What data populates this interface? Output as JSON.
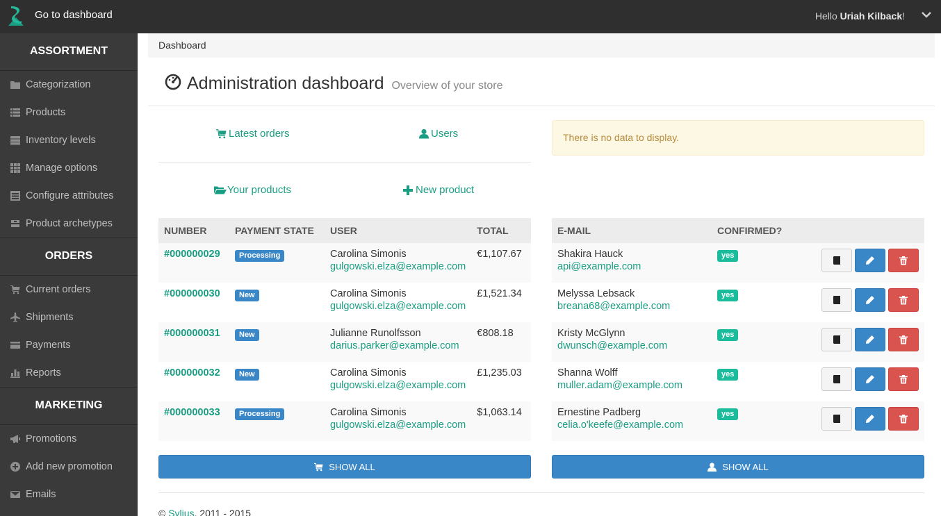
{
  "topbar": {
    "brand_label": "Go to dashboard",
    "hello_prefix": "Hello",
    "user_name": "Uriah Kilback",
    "hello_suffix": "!"
  },
  "sidebar": {
    "sections": [
      {
        "title": "ASSORTMENT",
        "items": [
          {
            "label": "Categorization",
            "icon": "folder-icon"
          },
          {
            "label": "Products",
            "icon": "list-icon"
          },
          {
            "label": "Inventory levels",
            "icon": "tasks-icon"
          },
          {
            "label": "Manage options",
            "icon": "grid-icon"
          },
          {
            "label": "Configure attributes",
            "icon": "list-alt-icon"
          },
          {
            "label": "Product archetypes",
            "icon": "compressed-icon"
          }
        ]
      },
      {
        "title": "ORDERS",
        "items": [
          {
            "label": "Current orders",
            "icon": "cart-icon"
          },
          {
            "label": "Shipments",
            "icon": "plane-icon"
          },
          {
            "label": "Payments",
            "icon": "credit-card-icon"
          },
          {
            "label": "Reports",
            "icon": "stats-icon"
          }
        ]
      },
      {
        "title": "MARKETING",
        "items": [
          {
            "label": "Promotions",
            "icon": "bullhorn-icon"
          },
          {
            "label": "Add new promotion",
            "icon": "plus-circle-icon"
          },
          {
            "label": "Emails",
            "icon": "envelope-icon"
          }
        ]
      }
    ]
  },
  "breadcrumb": "Dashboard",
  "header": {
    "title": "Administration dashboard",
    "subtitle": "Overview of your store"
  },
  "quick_links": {
    "latest_orders": "Latest orders",
    "users": "Users",
    "your_products": "Your products",
    "new_product": "New product"
  },
  "alert": "There is no data to display.",
  "orders": {
    "columns": [
      "NUMBER",
      "PAYMENT STATE",
      "USER",
      "TOTAL"
    ],
    "rows": [
      {
        "number": "#000000029",
        "state": "Processing",
        "user": "Carolina Simonis",
        "email": "gulgowski.elza@example.com",
        "total": "€1,107.67"
      },
      {
        "number": "#000000030",
        "state": "New",
        "user": "Carolina Simonis",
        "email": "gulgowski.elza@example.com",
        "total": "£1,521.34"
      },
      {
        "number": "#000000031",
        "state": "New",
        "user": "Julianne Runolfsson",
        "email": "darius.parker@example.com",
        "total": "€808.18"
      },
      {
        "number": "#000000032",
        "state": "New",
        "user": "Carolina Simonis",
        "email": "gulgowski.elza@example.com",
        "total": "£1,235.03"
      },
      {
        "number": "#000000033",
        "state": "Processing",
        "user": "Carolina Simonis",
        "email": "gulgowski.elza@example.com",
        "total": "$1,063.14"
      }
    ],
    "show_all": "SHOW ALL"
  },
  "users": {
    "columns": [
      "E-MAIL",
      "CONFIRMED?",
      ""
    ],
    "rows": [
      {
        "name": "Shakira Hauck",
        "email": "api@example.com",
        "confirmed": "yes"
      },
      {
        "name": "Melyssa Lebsack",
        "email": "breana68@example.com",
        "confirmed": "yes"
      },
      {
        "name": "Kristy McGlynn",
        "email": "dwunsch@example.com",
        "confirmed": "yes"
      },
      {
        "name": "Shanna Wolff",
        "email": "muller.adam@example.com",
        "confirmed": "yes"
      },
      {
        "name": "Ernestine Padberg",
        "email": "celia.o'keefe@example.com",
        "confirmed": "yes"
      }
    ],
    "show_all": "SHOW ALL"
  },
  "footer": {
    "copyright": "©",
    "link": "Sylius",
    "years": ", 2011 - 2015"
  },
  "colors": {
    "accent": "#1a9e83",
    "primary": "#3a87c8",
    "danger": "#d9534f",
    "sidebar": "#3a3a3a",
    "topbar": "#2f2f2f"
  }
}
